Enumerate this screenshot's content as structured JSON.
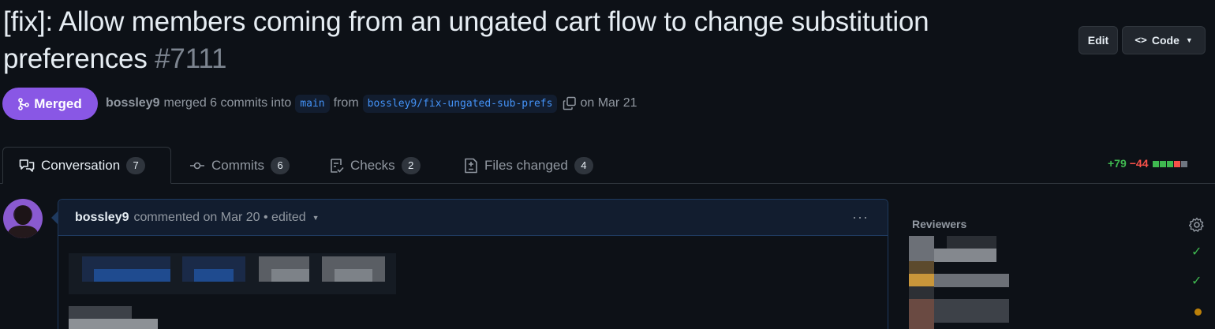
{
  "pr": {
    "title": "[fix]: Allow members coming from an ungated cart flow to change substitution preferences",
    "number": "#7111",
    "status": "Merged",
    "author": "bossley9",
    "action": "merged 6 commits into",
    "base_branch": "main",
    "from_text": "from",
    "head_branch": "bossley9/fix-ungated-sub-prefs",
    "date": "on Mar 21"
  },
  "header_actions": {
    "edit_label": "Edit",
    "code_label": "Code"
  },
  "tabs": [
    {
      "label": "Conversation",
      "count": "7",
      "icon": "comment-discussion-icon"
    },
    {
      "label": "Commits",
      "count": "6",
      "icon": "git-commit-icon"
    },
    {
      "label": "Checks",
      "count": "2",
      "icon": "checklist-icon"
    },
    {
      "label": "Files changed",
      "count": "4",
      "icon": "file-diff-icon"
    }
  ],
  "diffstat": {
    "additions": "+79",
    "deletions": "−44",
    "colors": {
      "add": "#3fb950",
      "del": "#f85149",
      "neutral": "#6e7681"
    }
  },
  "comment": {
    "author": "bossley9",
    "meta": "commented on Mar 20 • edited"
  },
  "sidebar": {
    "reviewers_label": "Reviewers",
    "reviewer_states": [
      "approved",
      "approved",
      "pending"
    ]
  },
  "colors": {
    "background": "#0d1117",
    "merged": "#8957e5",
    "link": "#4493f8"
  }
}
